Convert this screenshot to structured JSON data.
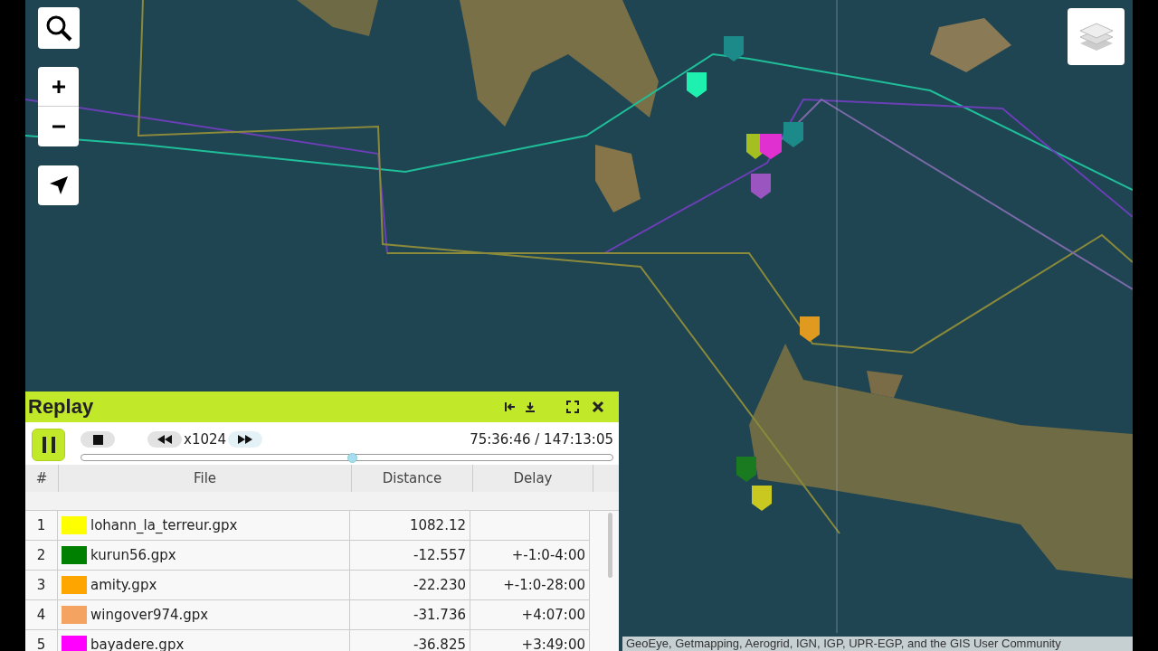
{
  "panel": {
    "title": "Replay",
    "playing": true,
    "speed": "x1024",
    "time": "75:36:46 / 147:13:05",
    "progress": {
      "level": 0.51
    }
  },
  "table": {
    "columns": [
      "#",
      "File",
      "Distance",
      "Delay"
    ],
    "rows": [
      {
        "index": "1",
        "file": "lohann_la_terreur.gpx",
        "color": "#ffff00",
        "distance": "1082.12"
      },
      {
        "index": "2",
        "file": "kurun56.gpx",
        "color": "#008000",
        "distance": "-12.557",
        "delay": "+-1:0-4:00"
      },
      {
        "index": "3",
        "file": "amity.gpx",
        "color": "#ffa500",
        "distance": "-22.230",
        "delay": "+-1:0-28:00"
      },
      {
        "index": "4",
        "file": "wingover974.gpx",
        "color": "#f4a460",
        "distance": "-31.736",
        "delay": "+4:07:00"
      },
      {
        "index": "5",
        "file": "bayadere.gpx",
        "color": "#ff00ff",
        "distance": "-36.825",
        "delay": "+3:49:00"
      }
    ]
  },
  "attribution": "GeoEye, Getmapping, Aerogrid, IGN, IGP, UPR-EGP, and the GIS User Community"
}
